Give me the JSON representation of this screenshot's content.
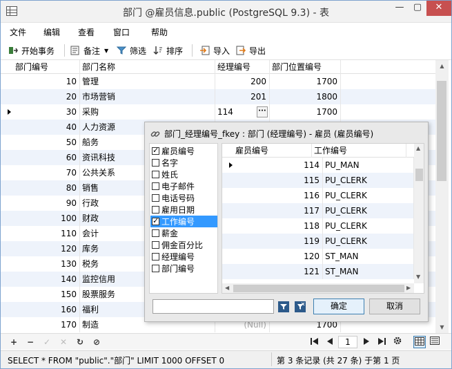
{
  "window": {
    "title": "部门 @雇员信息.public (PostgreSQL 9.3) - 表",
    "min": "—",
    "max": "▢",
    "close": "✕"
  },
  "menu": [
    "文件",
    "编辑",
    "查看",
    "窗口",
    "帮助"
  ],
  "toolbar": {
    "begin_tx": "开始事务",
    "note": "备注",
    "filter": "筛选",
    "sort": "排序",
    "import": "导入",
    "export": "导出"
  },
  "columns": [
    "部门编号",
    "部门名称",
    "经理编号",
    "部门位置编号"
  ],
  "rows": [
    {
      "id": "10",
      "name": "管理",
      "mgr": "200",
      "loc": "1700"
    },
    {
      "id": "20",
      "name": "市场营销",
      "mgr": "201",
      "loc": "1800"
    },
    {
      "id": "30",
      "name": "采购",
      "mgr": "114",
      "loc": "1700"
    },
    {
      "id": "40",
      "name": "人力资源",
      "mgr": "",
      "loc": ""
    },
    {
      "id": "50",
      "name": "船务",
      "mgr": "",
      "loc": ""
    },
    {
      "id": "60",
      "name": "资讯科技",
      "mgr": "",
      "loc": ""
    },
    {
      "id": "70",
      "name": "公共关系",
      "mgr": "",
      "loc": ""
    },
    {
      "id": "80",
      "name": "销售",
      "mgr": "",
      "loc": ""
    },
    {
      "id": "90",
      "name": "行政",
      "mgr": "",
      "loc": ""
    },
    {
      "id": "100",
      "name": "财政",
      "mgr": "",
      "loc": ""
    },
    {
      "id": "110",
      "name": "会计",
      "mgr": "",
      "loc": ""
    },
    {
      "id": "120",
      "name": "库务",
      "mgr": "",
      "loc": ""
    },
    {
      "id": "130",
      "name": "税务",
      "mgr": "",
      "loc": ""
    },
    {
      "id": "140",
      "name": "监控信用",
      "mgr": "",
      "loc": ""
    },
    {
      "id": "150",
      "name": "股票服务",
      "mgr": "",
      "loc": ""
    },
    {
      "id": "160",
      "name": "福利",
      "mgr": "",
      "loc": ""
    },
    {
      "id": "170",
      "name": "制造",
      "mgr": "(Null)",
      "loc": "1700"
    }
  ],
  "popup": {
    "title": "部门_经理编号_fkey : 部门 (经理编号) - 雇员 (雇员编号)",
    "fields": [
      {
        "label": "雇员编号",
        "checked": true
      },
      {
        "label": "名字",
        "checked": false
      },
      {
        "label": "姓氏",
        "checked": false
      },
      {
        "label": "电子邮件",
        "checked": false
      },
      {
        "label": "电话号码",
        "checked": false
      },
      {
        "label": "雇用日期",
        "checked": false
      },
      {
        "label": "工作编号",
        "checked": true
      },
      {
        "label": "薪金",
        "checked": false
      },
      {
        "label": "佣金百分比",
        "checked": false
      },
      {
        "label": "经理编号",
        "checked": false
      },
      {
        "label": "部门编号",
        "checked": false
      }
    ],
    "sub_columns": [
      "雇员编号",
      "工作编号"
    ],
    "sub_rows": [
      {
        "emp": "114",
        "job": "PU_MAN"
      },
      {
        "emp": "115",
        "job": "PU_CLERK"
      },
      {
        "emp": "116",
        "job": "PU_CLERK"
      },
      {
        "emp": "117",
        "job": "PU_CLERK"
      },
      {
        "emp": "118",
        "job": "PU_CLERK"
      },
      {
        "emp": "119",
        "job": "PU_CLERK"
      },
      {
        "emp": "120",
        "job": "ST_MAN"
      },
      {
        "emp": "121",
        "job": "ST_MAN"
      }
    ],
    "filter_value": "",
    "ok": "确定",
    "cancel": "取消"
  },
  "nav": {
    "add": "+",
    "delete": "−",
    "apply": "✓",
    "discard": "✕",
    "refresh": "↻",
    "stop": "⊘",
    "page": "1"
  },
  "status": {
    "sql": "SELECT * FROM \"public\".\"部门\" LIMIT 1000 OFFSET 0",
    "record": "第 3 条记录 (共 27 条) 于第 1 页"
  },
  "icons": {
    "edit_dots": "···"
  },
  "colors": {
    "selection": "#3399ff",
    "close_button": "#c75050",
    "alt_row": "#eef3fb"
  }
}
